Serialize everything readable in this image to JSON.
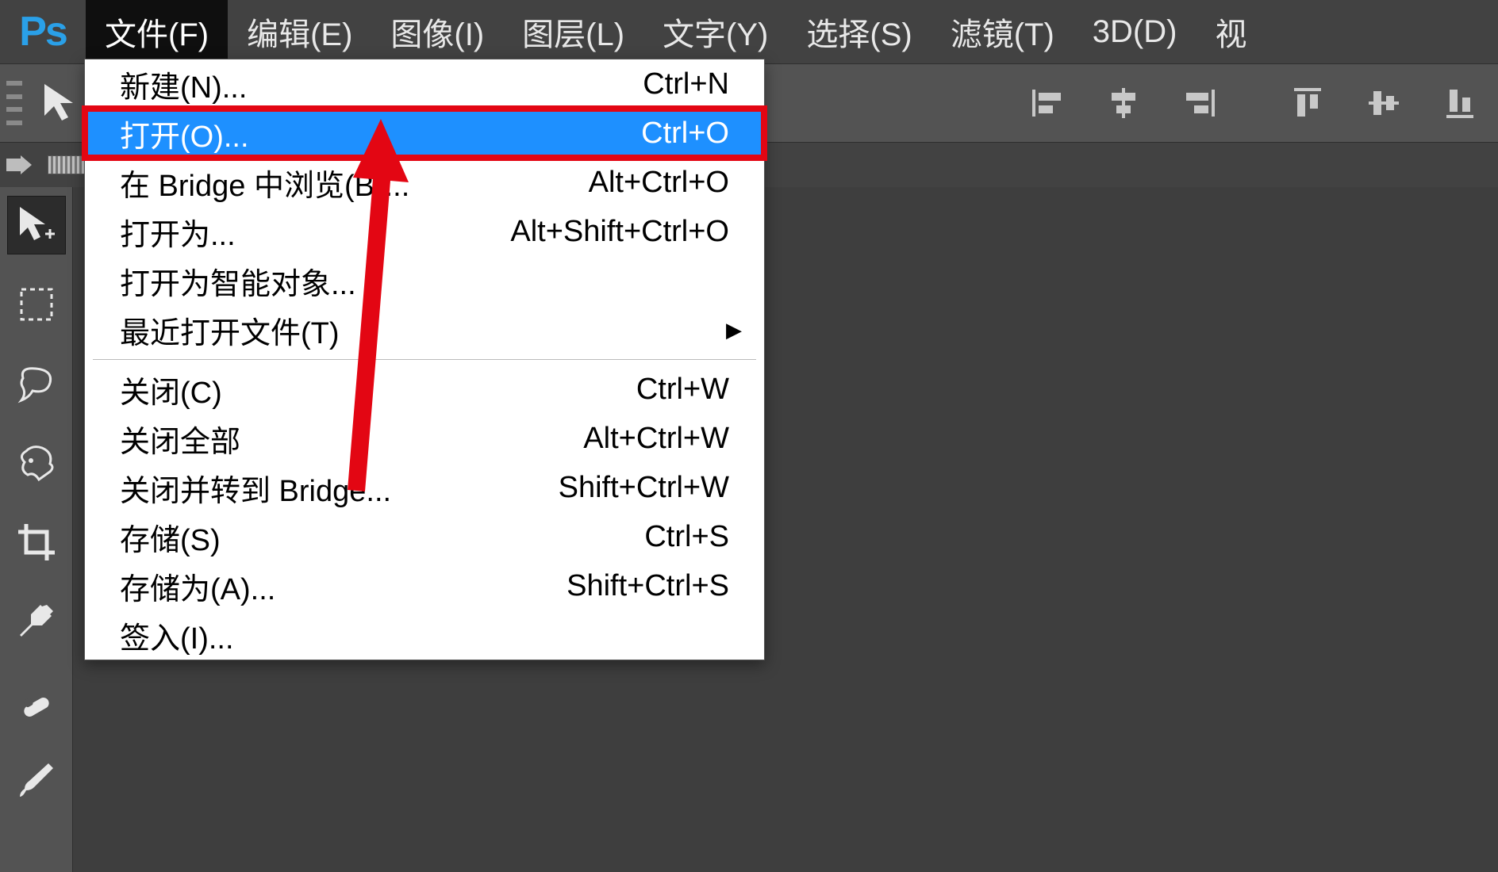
{
  "app": {
    "logo_text": "Ps"
  },
  "menu": [
    {
      "id": "file",
      "label": "文件(F)",
      "active": true
    },
    {
      "id": "edit",
      "label": "编辑(E)"
    },
    {
      "id": "image",
      "label": "图像(I)"
    },
    {
      "id": "layer",
      "label": "图层(L)"
    },
    {
      "id": "type",
      "label": "文字(Y)"
    },
    {
      "id": "select",
      "label": "选择(S)"
    },
    {
      "id": "filter",
      "label": "滤镜(T)"
    },
    {
      "id": "3d",
      "label": "3D(D)"
    },
    {
      "id": "view",
      "label": "视"
    }
  ],
  "dropdown": {
    "items": [
      {
        "label": "新建(N)...",
        "shortcut": "Ctrl+N"
      },
      {
        "label": "打开(O)...",
        "shortcut": "Ctrl+O",
        "highlight": true
      },
      {
        "label": "在 Bridge 中浏览(B)...",
        "shortcut": "Alt+Ctrl+O"
      },
      {
        "label": "打开为...",
        "shortcut": "Alt+Shift+Ctrl+O"
      },
      {
        "label": "打开为智能对象..."
      },
      {
        "label": "最近打开文件(T)",
        "submenu": true
      },
      {
        "sep": true
      },
      {
        "label": "关闭(C)",
        "shortcut": "Ctrl+W"
      },
      {
        "label": "关闭全部",
        "shortcut": "Alt+Ctrl+W"
      },
      {
        "label": "关闭并转到 Bridge...",
        "shortcut": "Shift+Ctrl+W"
      },
      {
        "label": "存储(S)",
        "shortcut": "Ctrl+S"
      },
      {
        "label": "存储为(A)...",
        "shortcut": "Shift+Ctrl+S"
      },
      {
        "label": "签入(I)..."
      }
    ]
  },
  "tools": [
    {
      "id": "move",
      "name": "move-tool",
      "selected": true
    },
    {
      "id": "marquee",
      "name": "rectangular-marquee-tool"
    },
    {
      "id": "lasso",
      "name": "lasso-tool"
    },
    {
      "id": "quickselect",
      "name": "quick-selection-tool"
    },
    {
      "id": "crop",
      "name": "crop-tool"
    },
    {
      "id": "eyedropper",
      "name": "eyedropper-tool"
    },
    {
      "id": "healing",
      "name": "healing-brush-tool"
    },
    {
      "id": "brush",
      "name": "brush-tool"
    }
  ],
  "optionbar_icons": [
    {
      "name": "align-left-edges-icon"
    },
    {
      "name": "align-horizontal-centers-icon"
    },
    {
      "name": "align-right-edges-icon"
    },
    {
      "name": "align-top-edges-icon"
    },
    {
      "name": "align-vertical-centers-icon"
    },
    {
      "name": "align-bottom-edges-icon"
    }
  ],
  "colors": {
    "highlight": "#1e90ff",
    "annotation": "#e30613",
    "logo": "#2aa0e8"
  }
}
